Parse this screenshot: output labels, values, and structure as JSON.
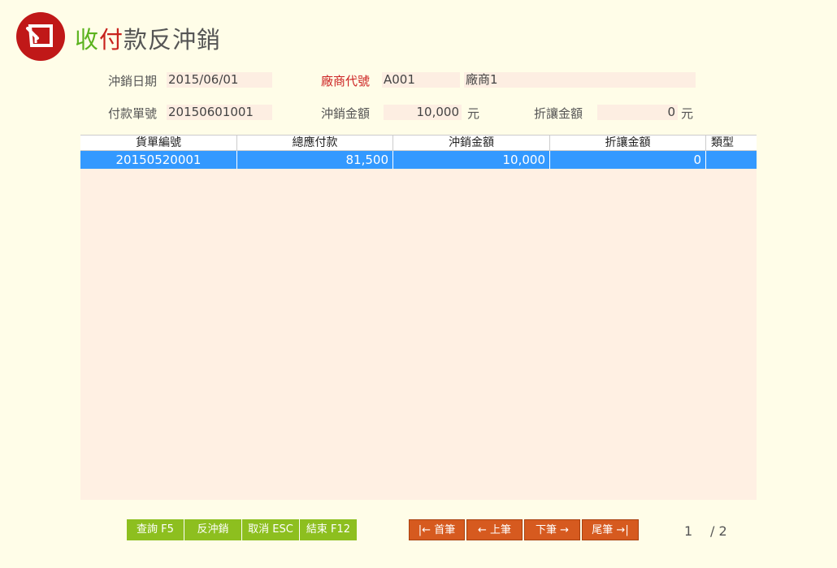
{
  "header": {
    "title_part1": "收",
    "title_part2": "付",
    "title_part3": "款反沖銷"
  },
  "form": {
    "date_label": "沖銷日期",
    "date_value": "2015/06/01",
    "vendor_code_label": "廠商代號",
    "vendor_code_value": "A001",
    "vendor_name_value": "廠商1",
    "payment_no_label": "付款單號",
    "payment_no_value": "20150601001",
    "writeoff_amount_label": "沖銷金額",
    "writeoff_amount_value": "10,000",
    "writeoff_amount_unit": "元",
    "discount_label": "折讓金額",
    "discount_value": "0",
    "discount_unit": "元"
  },
  "grid": {
    "columns": [
      "貨單編號",
      "總應付款",
      "沖銷金額",
      "折讓金額",
      "類型"
    ],
    "rows": [
      [
        "20150520001",
        "81,500",
        "10,000",
        "0",
        ""
      ]
    ]
  },
  "actions": {
    "query": "查詢 F5",
    "reverse": "反沖銷",
    "cancel": "取消 ESC",
    "close": "結束 F12"
  },
  "nav": {
    "first": "|← 首筆",
    "prev": "← 上筆",
    "next": "下筆 →",
    "last": "尾筆 →|"
  },
  "pager": {
    "current": "1",
    "total": "/ 2"
  },
  "colors": {
    "accent_green": "#8dbf1f",
    "accent_orange": "#d65a1f",
    "selection_blue": "#3399ff",
    "logo_red": "#c01818"
  }
}
